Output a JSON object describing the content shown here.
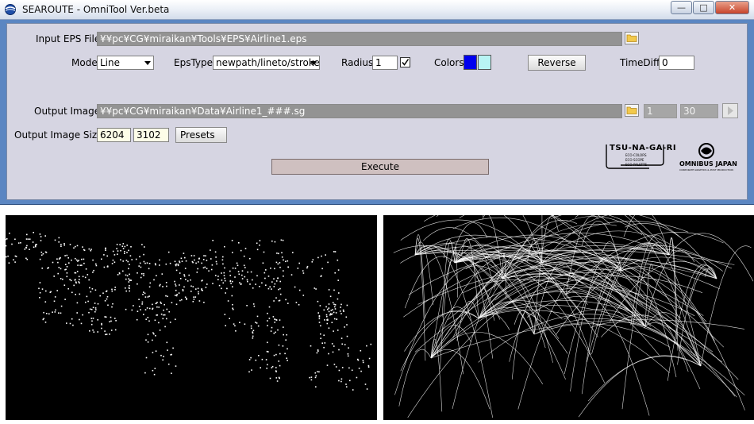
{
  "window": {
    "title": "SEAROUTE - OmniTool Ver.beta",
    "controls": {
      "minimize": "—",
      "maximize": "□",
      "close": "✕"
    }
  },
  "input": {
    "label": "Input EPS File",
    "path": "¥¥pc¥CG¥miraikan¥Tools¥EPS¥Airline1.eps"
  },
  "options": {
    "mode_label": "Mode",
    "mode_value": "Line",
    "epstype_label": "EpsType",
    "epstype_value": "newpath/lineto/stroke",
    "radius_label": "Radius",
    "radius_value": "1",
    "radius_checked": true,
    "colors_label": "Colors",
    "color1": "#0000ee",
    "color2": "#b8f4f4",
    "reverse_label": "Reverse",
    "timediff_label": "TimeDiff",
    "timediff_value": "0"
  },
  "output": {
    "label": "Output Image",
    "path": "¥¥pc¥CG¥miraikan¥Data¥Airline1_###.sg",
    "start_frame": "1",
    "end_frame": "30",
    "size_label": "Output Image Size",
    "width": "6204",
    "height": "3102",
    "presets_label": "Presets"
  },
  "execute_label": "Execute",
  "logos": {
    "tsunagari": "TSU-NA-GA-RI",
    "tsunagari_lines": [
      "ECO-COLORS",
      "ECO-SCOPE",
      "ECO-PALETTE"
    ],
    "omnibus": "OMNIBUS JAPAN",
    "omnibus_sub": "CORPORATE GRAPHICS & POST PRODUCTION"
  },
  "icons": {
    "folder": "folder-icon",
    "app": "globe-icon",
    "play": "play-icon"
  }
}
